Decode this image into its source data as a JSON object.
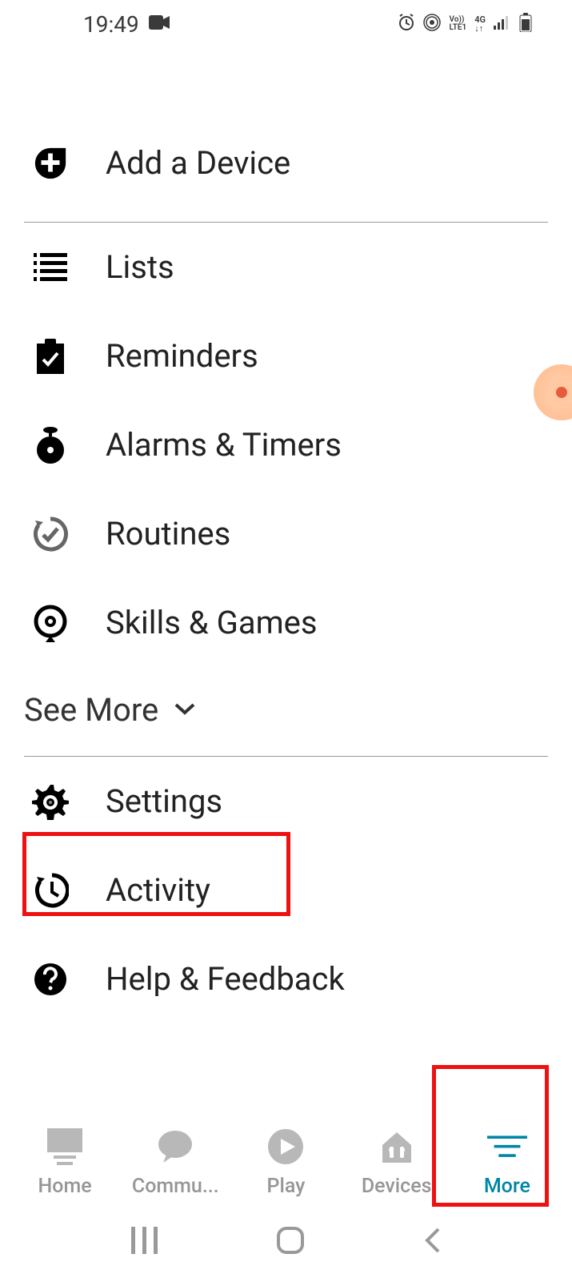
{
  "status": {
    "time": "19:49"
  },
  "menu": {
    "add_device": "Add a Device",
    "lists": "Lists",
    "reminders": "Reminders",
    "alarms": "Alarms & Timers",
    "routines": "Routines",
    "skills": "Skills & Games",
    "see_more": "See More",
    "settings": "Settings",
    "activity": "Activity",
    "help": "Help & Feedback"
  },
  "nav": {
    "home": "Home",
    "communicate": "Commu...",
    "play": "Play",
    "devices": "Devices",
    "more": "More"
  }
}
